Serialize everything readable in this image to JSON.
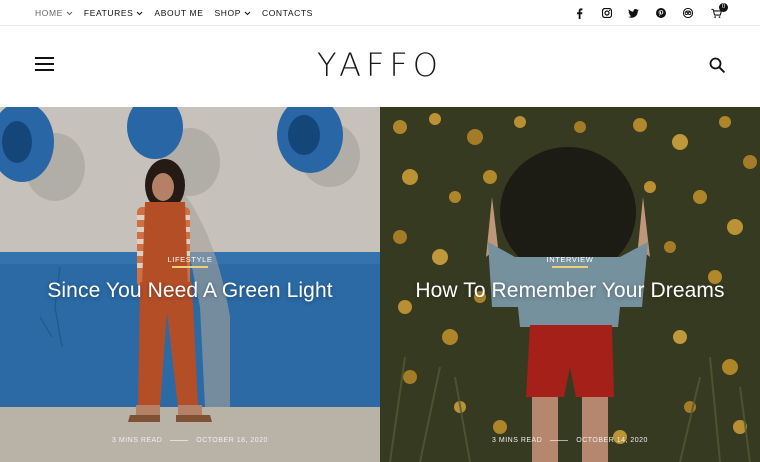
{
  "topnav": {
    "items": [
      {
        "label": "HOME",
        "has_dropdown": true
      },
      {
        "label": "FEATURES",
        "has_dropdown": true
      },
      {
        "label": "ABOUT ME",
        "has_dropdown": false
      },
      {
        "label": "SHOP",
        "has_dropdown": true
      },
      {
        "label": "CONTACTS",
        "has_dropdown": false
      }
    ]
  },
  "social": {
    "icons": [
      "facebook-icon",
      "instagram-icon",
      "twitter-icon",
      "pinterest-icon",
      "tripadvisor-icon"
    ],
    "cart_count": "0"
  },
  "header": {
    "logo": "YAFFO"
  },
  "posts": [
    {
      "category": "LIFESTYLE",
      "title": "Since You Need A Green Light",
      "read_time": "3 MINS READ",
      "date": "OCTOBER 18, 2020"
    },
    {
      "category": "INTERVIEW",
      "title": "How To Remember Your Dreams",
      "read_time": "3 MINS READ",
      "date": "OCTOBER 14, 2020"
    }
  ],
  "colors": {
    "accent_underline": "#e8d17a",
    "text_dark": "#111111"
  }
}
